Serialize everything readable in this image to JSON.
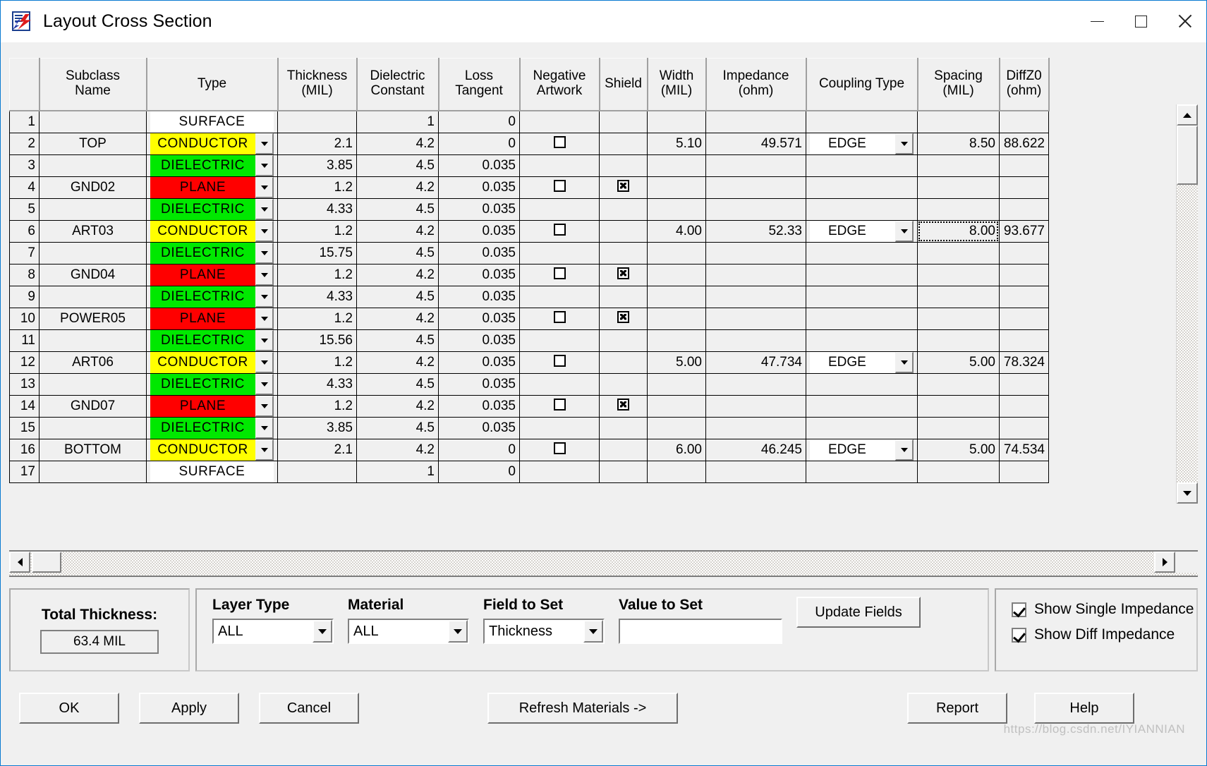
{
  "window": {
    "title": "Layout Cross Section",
    "icon": "allegro-app-icon",
    "minimize_label": "─",
    "maximize_label": "□",
    "close_label": "✕"
  },
  "grid": {
    "columns": [
      {
        "key": "rownum",
        "label": ""
      },
      {
        "key": "subclass_name",
        "label": "Subclass\nName"
      },
      {
        "key": "type",
        "label": "Type"
      },
      {
        "key": "thickness",
        "label": "Thickness\n(MIL)"
      },
      {
        "key": "dielectric_constant",
        "label": "Dielectric\nConstant"
      },
      {
        "key": "loss_tangent",
        "label": "Loss\nTangent"
      },
      {
        "key": "negative_artwork",
        "label": "Negative\nArtwork"
      },
      {
        "key": "shield",
        "label": "Shield"
      },
      {
        "key": "width",
        "label": "Width\n(MIL)"
      },
      {
        "key": "impedance",
        "label": "Impedance\n(ohm)"
      },
      {
        "key": "coupling_type",
        "label": "Coupling Type"
      },
      {
        "key": "spacing",
        "label": "Spacing\n(MIL)"
      },
      {
        "key": "diffz0",
        "label": "DiffZ0\n(ohm)"
      }
    ],
    "rows": [
      {
        "n": "1",
        "name": "",
        "name_ro": true,
        "type": "SURFACE",
        "type_color": "surface",
        "has_dd": false,
        "thickness": "",
        "dk": "1",
        "lt": "0",
        "neg": null,
        "shield": null,
        "width": "",
        "imp": "",
        "coupling": "",
        "spacing": "",
        "diffz0": ""
      },
      {
        "n": "2",
        "name": "TOP",
        "name_ro": false,
        "type": "CONDUCTOR",
        "type_color": "cond",
        "has_dd": true,
        "thickness": "2.1",
        "dk": "4.2",
        "lt": "0",
        "neg": false,
        "shield": null,
        "width": "5.10",
        "imp": "49.571",
        "coupling": "EDGE",
        "spacing": "8.50",
        "diffz0": "88.622"
      },
      {
        "n": "3",
        "name": "",
        "name_ro": false,
        "type": "DIELECTRIC",
        "type_color": "diel",
        "has_dd": true,
        "thickness": "3.85",
        "dk": "4.5",
        "lt": "0.035",
        "neg": null,
        "shield": null,
        "width": "",
        "imp": "",
        "coupling": "",
        "spacing": "",
        "diffz0": ""
      },
      {
        "n": "4",
        "name": "GND02",
        "name_ro": false,
        "type": "PLANE",
        "type_color": "plane",
        "has_dd": true,
        "thickness": "1.2",
        "dk": "4.2",
        "lt": "0.035",
        "neg": false,
        "shield": true,
        "width": "",
        "imp": "",
        "coupling": "",
        "spacing": "",
        "diffz0": ""
      },
      {
        "n": "5",
        "name": "",
        "name_ro": false,
        "type": "DIELECTRIC",
        "type_color": "diel",
        "has_dd": true,
        "thickness": "4.33",
        "dk": "4.5",
        "lt": "0.035",
        "neg": null,
        "shield": null,
        "width": "",
        "imp": "",
        "coupling": "",
        "spacing": "",
        "diffz0": ""
      },
      {
        "n": "6",
        "name": "ART03",
        "name_ro": false,
        "type": "CONDUCTOR",
        "type_color": "cond",
        "has_dd": true,
        "thickness": "1.2",
        "dk": "4.2",
        "lt": "0.035",
        "neg": false,
        "shield": null,
        "width": "4.00",
        "imp": "52.33",
        "coupling": "EDGE",
        "spacing": "8.00",
        "diffz0": "93.677",
        "spacing_focus": true
      },
      {
        "n": "7",
        "name": "",
        "name_ro": false,
        "type": "DIELECTRIC",
        "type_color": "diel",
        "has_dd": true,
        "thickness": "15.75",
        "dk": "4.5",
        "lt": "0.035",
        "neg": null,
        "shield": null,
        "width": "",
        "imp": "",
        "coupling": "",
        "spacing": "",
        "diffz0": ""
      },
      {
        "n": "8",
        "name": "GND04",
        "name_ro": false,
        "type": "PLANE",
        "type_color": "plane",
        "has_dd": true,
        "thickness": "1.2",
        "dk": "4.2",
        "lt": "0.035",
        "neg": false,
        "shield": true,
        "width": "",
        "imp": "",
        "coupling": "",
        "spacing": "",
        "diffz0": ""
      },
      {
        "n": "9",
        "name": "",
        "name_ro": false,
        "type": "DIELECTRIC",
        "type_color": "diel",
        "has_dd": true,
        "thickness": "4.33",
        "dk": "4.5",
        "lt": "0.035",
        "neg": null,
        "shield": null,
        "width": "",
        "imp": "",
        "coupling": "",
        "spacing": "",
        "diffz0": ""
      },
      {
        "n": "10",
        "name": "POWER05",
        "name_ro": false,
        "type": "PLANE",
        "type_color": "plane",
        "has_dd": true,
        "thickness": "1.2",
        "dk": "4.2",
        "lt": "0.035",
        "neg": false,
        "shield": true,
        "width": "",
        "imp": "",
        "coupling": "",
        "spacing": "",
        "diffz0": ""
      },
      {
        "n": "11",
        "name": "",
        "name_ro": false,
        "type": "DIELECTRIC",
        "type_color": "diel",
        "has_dd": true,
        "thickness": "15.56",
        "dk": "4.5",
        "lt": "0.035",
        "neg": null,
        "shield": null,
        "width": "",
        "imp": "",
        "coupling": "",
        "spacing": "",
        "diffz0": ""
      },
      {
        "n": "12",
        "name": "ART06",
        "name_ro": false,
        "type": "CONDUCTOR",
        "type_color": "cond",
        "has_dd": true,
        "thickness": "1.2",
        "dk": "4.2",
        "lt": "0.035",
        "neg": false,
        "shield": null,
        "width": "5.00",
        "imp": "47.734",
        "coupling": "EDGE",
        "spacing": "5.00",
        "diffz0": "78.324"
      },
      {
        "n": "13",
        "name": "",
        "name_ro": false,
        "type": "DIELECTRIC",
        "type_color": "diel",
        "has_dd": true,
        "thickness": "4.33",
        "dk": "4.5",
        "lt": "0.035",
        "neg": null,
        "shield": null,
        "width": "",
        "imp": "",
        "coupling": "",
        "spacing": "",
        "diffz0": ""
      },
      {
        "n": "14",
        "name": "GND07",
        "name_ro": false,
        "type": "PLANE",
        "type_color": "plane",
        "has_dd": true,
        "thickness": "1.2",
        "dk": "4.2",
        "lt": "0.035",
        "neg": false,
        "shield": true,
        "width": "",
        "imp": "",
        "coupling": "",
        "spacing": "",
        "diffz0": ""
      },
      {
        "n": "15",
        "name": "",
        "name_ro": false,
        "type": "DIELECTRIC",
        "type_color": "diel",
        "has_dd": true,
        "thickness": "3.85",
        "dk": "4.5",
        "lt": "0.035",
        "neg": null,
        "shield": null,
        "width": "",
        "imp": "",
        "coupling": "",
        "spacing": "",
        "diffz0": ""
      },
      {
        "n": "16",
        "name": "BOTTOM",
        "name_ro": true,
        "type": "CONDUCTOR",
        "type_color": "cond",
        "has_dd": true,
        "thickness": "2.1",
        "dk": "4.2",
        "lt": "0",
        "neg": false,
        "shield": null,
        "width": "6.00",
        "imp": "46.245",
        "coupling": "EDGE",
        "spacing": "5.00",
        "diffz0": "74.534"
      },
      {
        "n": "17",
        "name": "",
        "name_ro": true,
        "type": "SURFACE",
        "type_color": "surface",
        "has_dd": false,
        "thickness": "",
        "dk": "1",
        "lt": "0",
        "neg": null,
        "shield": null,
        "width": "",
        "imp": "",
        "coupling": "",
        "spacing": "",
        "diffz0": ""
      }
    ]
  },
  "total_thickness": {
    "label": "Total Thickness:",
    "value": "63.4 MIL"
  },
  "update_panel": {
    "layer_type": {
      "label": "Layer Type",
      "value": "ALL"
    },
    "material": {
      "label": "Material",
      "value": "ALL"
    },
    "field_to_set": {
      "label": "Field to Set",
      "value": "Thickness"
    },
    "value_to_set": {
      "label": "Value to Set",
      "value": "",
      "placeholder": ""
    },
    "update_button": "Update Fields"
  },
  "show_options": {
    "single": {
      "label": "Show Single Impedance",
      "checked": true
    },
    "diff": {
      "label": "Show Diff Impedance",
      "checked": true
    }
  },
  "footer": {
    "ok": "OK",
    "apply": "Apply",
    "cancel": "Cancel",
    "refresh": "Refresh Materials ->",
    "report": "Report",
    "help": "Help"
  },
  "watermark": "https://blog.csdn.net/IYIANNIAN"
}
